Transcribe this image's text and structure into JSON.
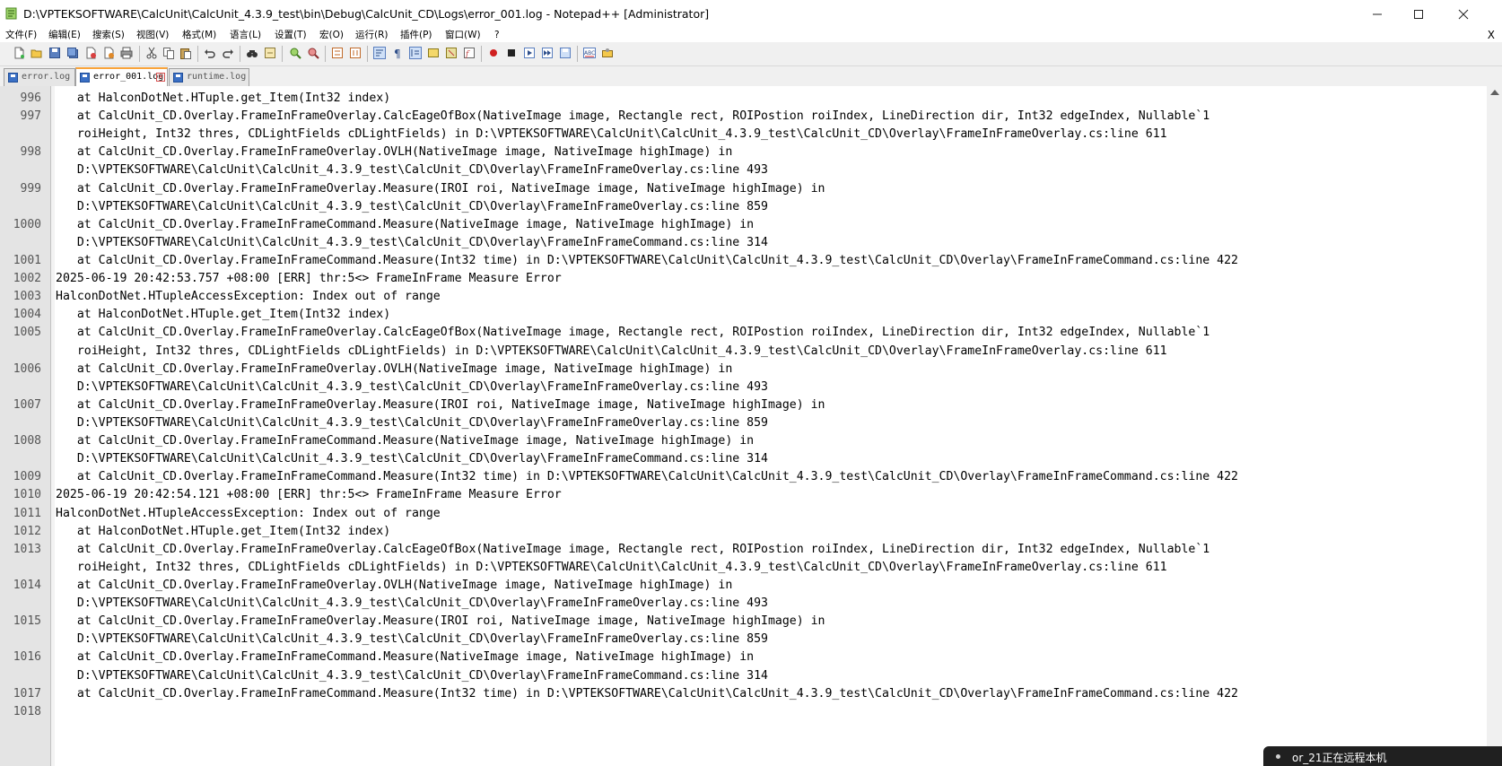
{
  "window": {
    "title": "D:\\VPTEKSOFTWARE\\CalcUnit\\CalcUnit_4.3.9_test\\bin\\Debug\\CalcUnit_CD\\Logs\\error_001.log - Notepad++ [Administrator]",
    "minimize_glyph": "—",
    "maximize_glyph": "☐",
    "close_glyph": "✕"
  },
  "menu": {
    "items": [
      "文件(F)",
      "编辑(E)",
      "搜索(S)",
      "视图(V)",
      "格式(M)",
      "语言(L)",
      "设置(T)",
      "宏(O)",
      "运行(R)",
      "插件(P)",
      "窗口(W)",
      "?"
    ],
    "close_label": "X"
  },
  "tabs": [
    {
      "label": "error.log",
      "active": false
    },
    {
      "label": "error_001.log",
      "active": true
    },
    {
      "label": "runtime.log",
      "active": false
    }
  ],
  "editor": {
    "lines": [
      {
        "num": "996",
        "text": "   at HalconDotNet.HTuple.get_Item(Int32 index)"
      },
      {
        "num": "997",
        "text": "   at CalcUnit_CD.Overlay.FrameInFrameOverlay.CalcEageOfBox(NativeImage image, Rectangle rect, ROIPostion roiIndex, LineDirection dir, Int32 edgeIndex, Nullable`1"
      },
      {
        "num": "",
        "text": "   roiHeight, Int32 thres, CDLightFields cDLightFields) in D:\\VPTEKSOFTWARE\\CalcUnit\\CalcUnit_4.3.9_test\\CalcUnit_CD\\Overlay\\FrameInFrameOverlay.cs:line 611"
      },
      {
        "num": "998",
        "text": "   at CalcUnit_CD.Overlay.FrameInFrameOverlay.OVLH(NativeImage image, NativeImage highImage) in"
      },
      {
        "num": "",
        "text": "   D:\\VPTEKSOFTWARE\\CalcUnit\\CalcUnit_4.3.9_test\\CalcUnit_CD\\Overlay\\FrameInFrameOverlay.cs:line 493"
      },
      {
        "num": "999",
        "text": "   at CalcUnit_CD.Overlay.FrameInFrameOverlay.Measure(IROI roi, NativeImage image, NativeImage highImage) in"
      },
      {
        "num": "",
        "text": "   D:\\VPTEKSOFTWARE\\CalcUnit\\CalcUnit_4.3.9_test\\CalcUnit_CD\\Overlay\\FrameInFrameOverlay.cs:line 859"
      },
      {
        "num": "1000",
        "text": "   at CalcUnit_CD.Overlay.FrameInFrameCommand.Measure(NativeImage image, NativeImage highImage) in"
      },
      {
        "num": "",
        "text": "   D:\\VPTEKSOFTWARE\\CalcUnit\\CalcUnit_4.3.9_test\\CalcUnit_CD\\Overlay\\FrameInFrameCommand.cs:line 314"
      },
      {
        "num": "1001",
        "text": "   at CalcUnit_CD.Overlay.FrameInFrameCommand.Measure(Int32 time) in D:\\VPTEKSOFTWARE\\CalcUnit\\CalcUnit_4.3.9_test\\CalcUnit_CD\\Overlay\\FrameInFrameCommand.cs:line 422"
      },
      {
        "num": "1002",
        "text": "2025-06-19 20:42:53.757 +08:00 [ERR] thr:5<> FrameInFrame Measure Error"
      },
      {
        "num": "1003",
        "text": "HalconDotNet.HTupleAccessException: Index out of range"
      },
      {
        "num": "1004",
        "text": "   at HalconDotNet.HTuple.get_Item(Int32 index)"
      },
      {
        "num": "1005",
        "text": "   at CalcUnit_CD.Overlay.FrameInFrameOverlay.CalcEageOfBox(NativeImage image, Rectangle rect, ROIPostion roiIndex, LineDirection dir, Int32 edgeIndex, Nullable`1"
      },
      {
        "num": "",
        "text": "   roiHeight, Int32 thres, CDLightFields cDLightFields) in D:\\VPTEKSOFTWARE\\CalcUnit\\CalcUnit_4.3.9_test\\CalcUnit_CD\\Overlay\\FrameInFrameOverlay.cs:line 611"
      },
      {
        "num": "1006",
        "text": "   at CalcUnit_CD.Overlay.FrameInFrameOverlay.OVLH(NativeImage image, NativeImage highImage) in"
      },
      {
        "num": "",
        "text": "   D:\\VPTEKSOFTWARE\\CalcUnit\\CalcUnit_4.3.9_test\\CalcUnit_CD\\Overlay\\FrameInFrameOverlay.cs:line 493"
      },
      {
        "num": "1007",
        "text": "   at CalcUnit_CD.Overlay.FrameInFrameOverlay.Measure(IROI roi, NativeImage image, NativeImage highImage) in"
      },
      {
        "num": "",
        "text": "   D:\\VPTEKSOFTWARE\\CalcUnit\\CalcUnit_4.3.9_test\\CalcUnit_CD\\Overlay\\FrameInFrameOverlay.cs:line 859"
      },
      {
        "num": "1008",
        "text": "   at CalcUnit_CD.Overlay.FrameInFrameCommand.Measure(NativeImage image, NativeImage highImage) in"
      },
      {
        "num": "",
        "text": "   D:\\VPTEKSOFTWARE\\CalcUnit\\CalcUnit_4.3.9_test\\CalcUnit_CD\\Overlay\\FrameInFrameCommand.cs:line 314"
      },
      {
        "num": "1009",
        "text": "   at CalcUnit_CD.Overlay.FrameInFrameCommand.Measure(Int32 time) in D:\\VPTEKSOFTWARE\\CalcUnit\\CalcUnit_4.3.9_test\\CalcUnit_CD\\Overlay\\FrameInFrameCommand.cs:line 422"
      },
      {
        "num": "1010",
        "text": "2025-06-19 20:42:54.121 +08:00 [ERR] thr:5<> FrameInFrame Measure Error"
      },
      {
        "num": "1011",
        "text": "HalconDotNet.HTupleAccessException: Index out of range"
      },
      {
        "num": "1012",
        "text": "   at HalconDotNet.HTuple.get_Item(Int32 index)"
      },
      {
        "num": "1013",
        "text": "   at CalcUnit_CD.Overlay.FrameInFrameOverlay.CalcEageOfBox(NativeImage image, Rectangle rect, ROIPostion roiIndex, LineDirection dir, Int32 edgeIndex, Nullable`1"
      },
      {
        "num": "",
        "text": "   roiHeight, Int32 thres, CDLightFields cDLightFields) in D:\\VPTEKSOFTWARE\\CalcUnit\\CalcUnit_4.3.9_test\\CalcUnit_CD\\Overlay\\FrameInFrameOverlay.cs:line 611"
      },
      {
        "num": "1014",
        "text": "   at CalcUnit_CD.Overlay.FrameInFrameOverlay.OVLH(NativeImage image, NativeImage highImage) in"
      },
      {
        "num": "",
        "text": "   D:\\VPTEKSOFTWARE\\CalcUnit\\CalcUnit_4.3.9_test\\CalcUnit_CD\\Overlay\\FrameInFrameOverlay.cs:line 493"
      },
      {
        "num": "1015",
        "text": "   at CalcUnit_CD.Overlay.FrameInFrameOverlay.Measure(IROI roi, NativeImage image, NativeImage highImage) in"
      },
      {
        "num": "",
        "text": "   D:\\VPTEKSOFTWARE\\CalcUnit\\CalcUnit_4.3.9_test\\CalcUnit_CD\\Overlay\\FrameInFrameOverlay.cs:line 859"
      },
      {
        "num": "1016",
        "text": "   at CalcUnit_CD.Overlay.FrameInFrameCommand.Measure(NativeImage image, NativeImage highImage) in"
      },
      {
        "num": "",
        "text": "   D:\\VPTEKSOFTWARE\\CalcUnit\\CalcUnit_4.3.9_test\\CalcUnit_CD\\Overlay\\FrameInFrameCommand.cs:line 314"
      },
      {
        "num": "1017",
        "text": "   at CalcUnit_CD.Overlay.FrameInFrameCommand.Measure(Int32 time) in D:\\VPTEKSOFTWARE\\CalcUnit\\CalcUnit_4.3.9_test\\CalcUnit_CD\\Overlay\\FrameInFrameCommand.cs:line 422"
      },
      {
        "num": "1018",
        "text": ""
      }
    ]
  },
  "notification": {
    "text": "or_21正在远程本机"
  },
  "colors": {
    "active_tab_accent": "#f9a33a",
    "tab_icon": "#3a6fc4",
    "tab_close": "#d65050"
  }
}
